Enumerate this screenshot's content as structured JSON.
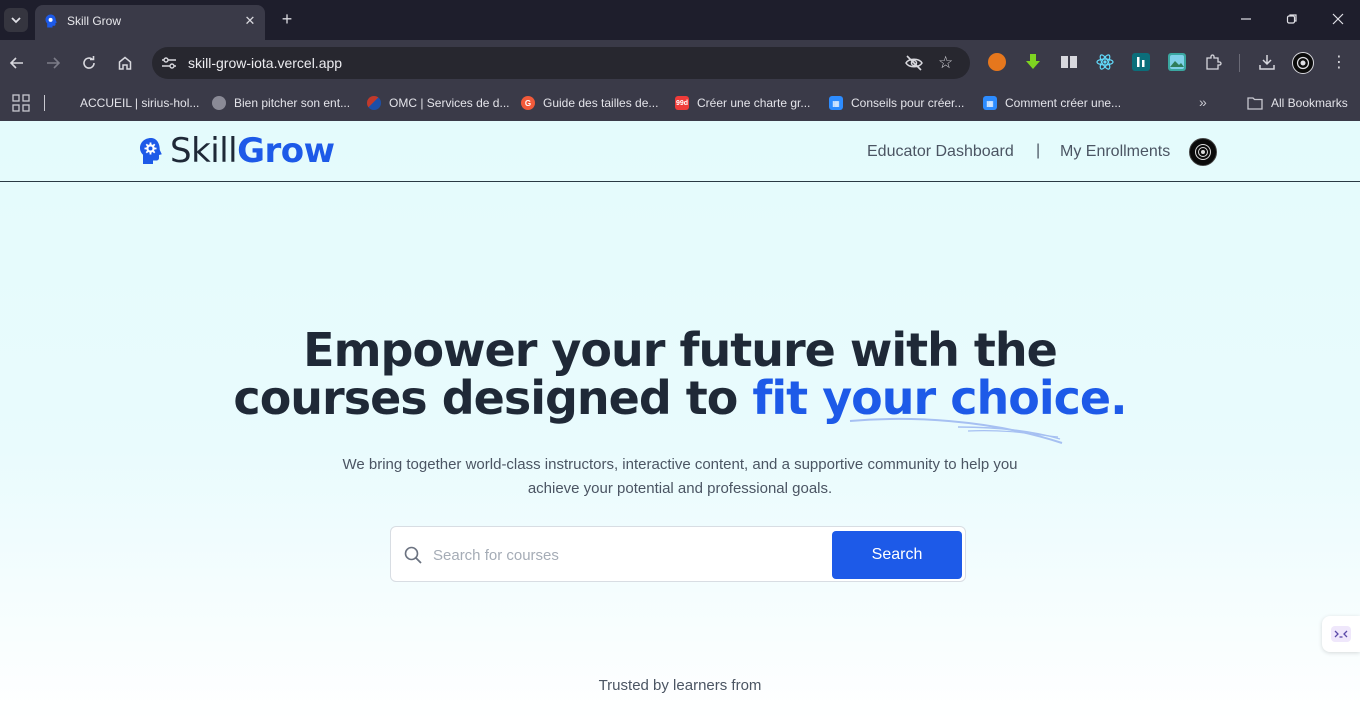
{
  "browser": {
    "tab": {
      "title": "Skill Grow"
    },
    "address": {
      "url": "skill-grow-iota.vercel.app"
    },
    "bookmarks": [
      {
        "label": "ACCUEIL | sirius-hol...",
        "icon": "blank-page-icon",
        "color": "#3a3a48"
      },
      {
        "label": "Bien pitcher son ent...",
        "icon": "globe-icon",
        "color": "#8a8a96"
      },
      {
        "label": "OMC | Services de d...",
        "icon": "omc-logo-icon",
        "color": "#c0392b"
      },
      {
        "label": "Guide des tailles de...",
        "icon": "g-logo-icon",
        "color": "#f15a3a"
      },
      {
        "label": "Créer une charte gr...",
        "icon": "99d-logo-icon",
        "color": "#ef3b39"
      },
      {
        "label": "Conseils pour créer...",
        "icon": "grid-logo-icon",
        "color": "#2d8cff"
      },
      {
        "label": "Comment créer une...",
        "icon": "grid-logo-icon",
        "color": "#2d8cff"
      }
    ],
    "all_bookmarks_label": "All Bookmarks"
  },
  "navbar": {
    "logo": {
      "part1": "Skill",
      "part2": "Grow"
    },
    "links": {
      "educator": "Educator Dashboard",
      "divider": "|",
      "enrollments": "My Enrollments"
    }
  },
  "hero": {
    "title_line1": "Empower your future with the",
    "title_line2_plain": "courses designed to ",
    "title_line2_accent": "fit your choice.",
    "subtitle": "We bring together world-class instructors, interactive content, and a supportive community to help you achieve your potential and professional goals."
  },
  "search": {
    "placeholder": "Search for courses",
    "value": "",
    "button_label": "Search"
  },
  "trusted": {
    "label": "Trusted by learners from"
  },
  "colors": {
    "brand": "#1d5ae8",
    "hero_bg": "#e4fbfc",
    "text": "#1f2937"
  }
}
